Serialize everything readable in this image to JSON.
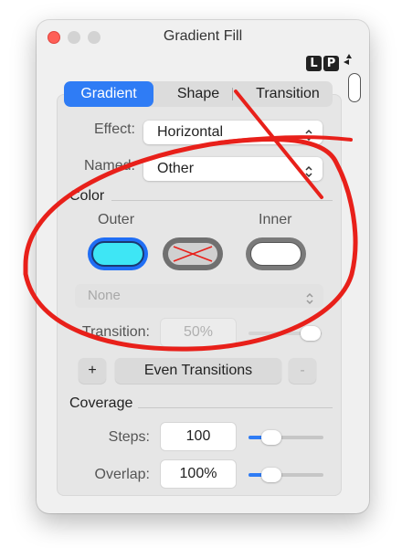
{
  "window": {
    "title": "Gradient Fill"
  },
  "logo": {
    "left": "L",
    "right": "P"
  },
  "tabs": [
    {
      "label": "Gradient",
      "active": true
    },
    {
      "label": "Shape",
      "active": false
    },
    {
      "label": "Transition",
      "active": false
    }
  ],
  "effect": {
    "label": "Effect:",
    "value": "Horizontal"
  },
  "named": {
    "label": "Named:",
    "value": "Other"
  },
  "color": {
    "section": "Color",
    "outer_label": "Outer",
    "inner_label": "Inner",
    "outer_color": "#3ee6f5",
    "inner_color": "#ffffff"
  },
  "preset": {
    "value": "None"
  },
  "transition": {
    "label": "Transition:",
    "value": "50%"
  },
  "buttons": {
    "plus": "+",
    "even": "Even Transitions",
    "minus": "-"
  },
  "coverage": {
    "section": "Coverage",
    "steps_label": "Steps:",
    "steps_value": "100",
    "overlap_label": "Overlap:",
    "overlap_value": "100%"
  },
  "annotation_color": "#e8201a",
  "chevron_glyph": "⌃⌄"
}
